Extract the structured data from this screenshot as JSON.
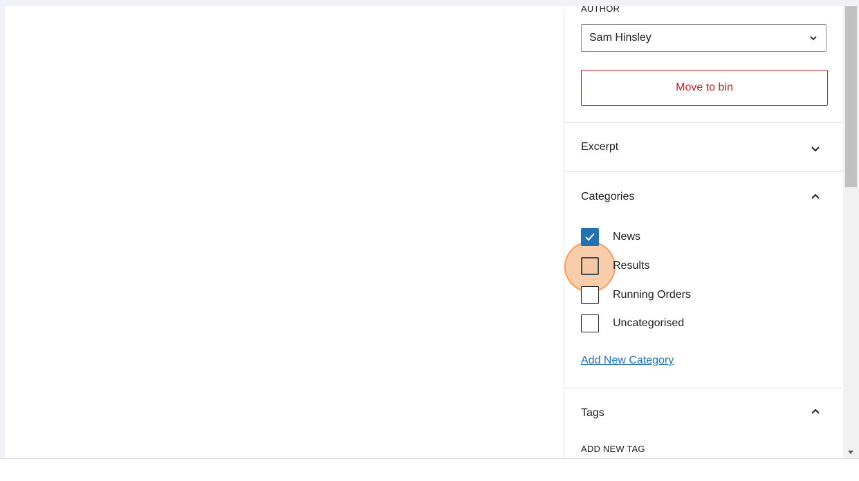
{
  "sidebar": {
    "author": {
      "label": "AUTHOR",
      "selected": "Sam Hinsley"
    },
    "bin_button": "Move to bin",
    "excerpt": {
      "title": "Excerpt"
    },
    "categories": {
      "title": "Categories",
      "items": [
        {
          "label": "News",
          "checked": true
        },
        {
          "label": "Results",
          "checked": false
        },
        {
          "label": "Running Orders",
          "checked": false
        },
        {
          "label": "Uncategorised",
          "checked": false
        }
      ],
      "add_new": "Add New Category"
    },
    "tags": {
      "title": "Tags",
      "add_new_label": "ADD NEW TAG"
    }
  },
  "colors": {
    "accent": "#2271b1",
    "danger": "#cc1818",
    "highlight": "#f6a464"
  }
}
